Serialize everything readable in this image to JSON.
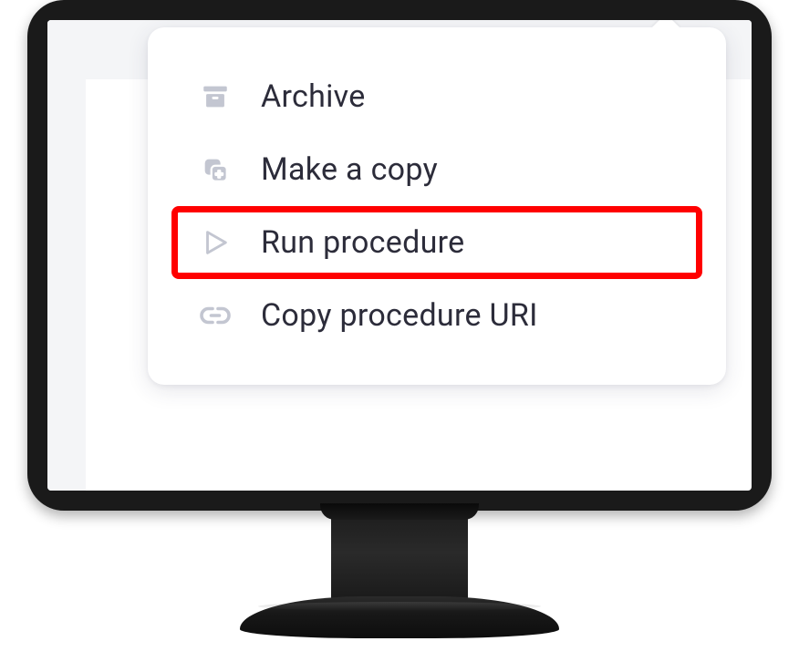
{
  "menu": {
    "items": [
      {
        "icon": "archive-icon",
        "label": "Archive",
        "highlighted": false
      },
      {
        "icon": "copy-icon",
        "label": "Make a copy",
        "highlighted": false
      },
      {
        "icon": "play-icon",
        "label": "Run procedure",
        "highlighted": true
      },
      {
        "icon": "link-icon",
        "label": "Copy procedure URI",
        "highlighted": false
      }
    ]
  },
  "colors": {
    "icon_fill": "#c3c6d1",
    "text": "#2c2c3a",
    "highlight_border": "#ff0000"
  }
}
